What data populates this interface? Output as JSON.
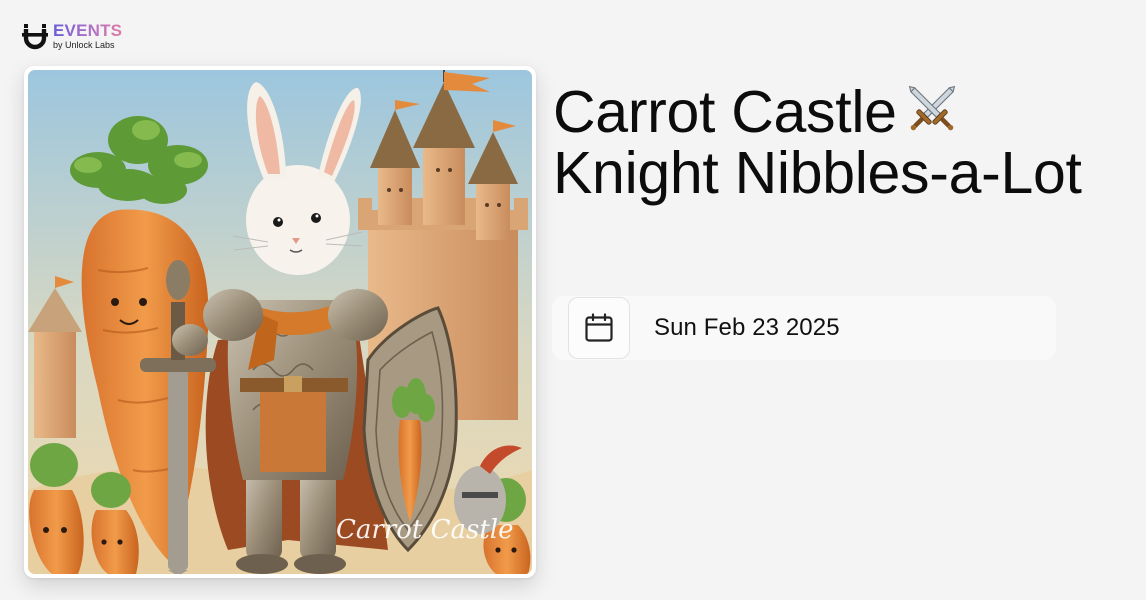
{
  "brand": {
    "logo_icon": "unlock-labs-u-logo",
    "events_label": "EVENTS",
    "byline": "by Unlock Labs"
  },
  "event": {
    "title": "Carrot Castle",
    "title_emoji_icon": "crossed-swords-icon",
    "title_rest": "Knight Nibbles-a-Lot",
    "date_icon": "calendar-icon",
    "date": "Sun Feb 23 2025",
    "image": {
      "description_icon": "rabbit-knight-artwork",
      "signature": "Carrot Castle"
    }
  },
  "colors": {
    "background": "#f4f4f4",
    "pill_bg": "#f9f9f9",
    "brand_gradient_start": "#6a5cd8",
    "brand_gradient_end": "#e07aa4"
  }
}
